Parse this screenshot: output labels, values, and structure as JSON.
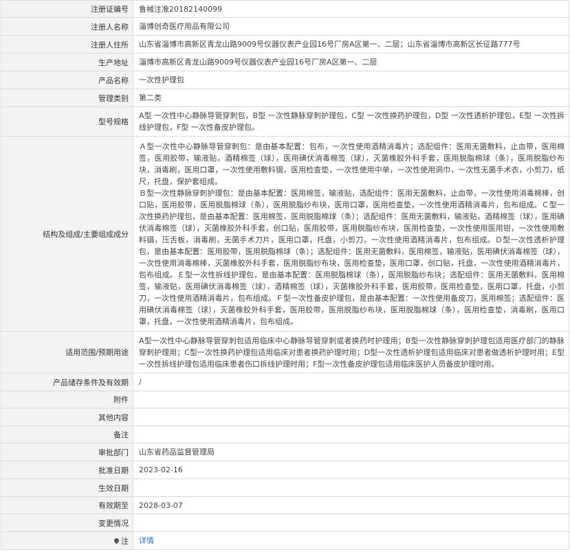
{
  "rows": [
    {
      "label": "注册证编号",
      "value": "鲁械注准20182140099"
    },
    {
      "label": "注册人名称",
      "value": "淄博创奇医疗用品有限公司"
    },
    {
      "label": "注册人住所",
      "value": "山东省淄博市高新区青龙山路9009号仪器仪表产业园16号厂房A区第一、二层；山东省淄博市高新区长征路777号"
    },
    {
      "label": "生产地址",
      "value": "淄博市高新区青龙山路9009号仪器仪表产业园16号厂房A区第一、二层"
    },
    {
      "label": "产品名称",
      "value": "一次性护理包"
    },
    {
      "label": "管理类别",
      "value": "第二类"
    },
    {
      "label": "型号规格",
      "value": "A型 一次性中心静脉导管穿刺包，B型 一次性静脉穿刺护理包，C型 一次性换药护理包，D型 一次性透析护理包，E型 一次性拆线护理包，F型 一次性备皮护理包。"
    },
    {
      "label": "结构及组成/主要组成成分",
      "value": "Ａ型一次性中心静脉导管穿刺包：是由基本配置：包布，一次性使用酒精消毒片；选配组件：医用无菌敷料，止血带，医用棉签，医用胶带，输液贴，酒精棉签（球），医用碘伏消毒棉签（球），灭菌橡胶外科手套，医用脱脂棉球（条），医用脱脂纱布块，消毒刷，医用口罩，一次性使用敷料镊，医用检查垫，一次性使用中单，一次性使用洞巾，一次性无菌手术衣，小剪刀，纸尺，托盘，保护套组成。\nＢ型一次性静脉穿刺护理包：是由基本配置：医用棉签，输液贴，选配组件：医用无菌敷料，止血带，一次性使用消毒棉棒，创口贴，医用胶带，医用脱脂棉球（条），医用脱脂纱布块，医用口罩，医用检查垫，一次性使用酒精消毒片，包布组成。Ｃ型一次性换药护理包，是由基本配置：医用棉签，医用脱脂棉球（条）；选配组件：医用无菌敷料，输液贴，酒精棉签（球），医用碘伏消毒棉签（球），灭菌橡胶外科手套，创口贴，医用胶带，医用脱脂纱布块，医用检查垫，一次性使用医用钳，一次性使用敷料镊，压舌板，消毒刷，无菌手术刀片，医用口罩，托盘，小剪刀，一次性使用酒精消毒片，包布组成。Ｄ型一次性透析护理包，是由基本配置：医用胶带，医用脱脂棉球（条）；选配组件：医用无菌敷料，医用棉签，输液贴，医用碘伏消毒棉签（球），一次性使用消毒棉棒，灭菌橡胶外科手套，医用脱脂纱布块，医用检查垫，医用口罩，创口贴，托盘，一次性使用酒精消毒片，包布组成。Ｅ型一次性拆线护理包，是由基本配置：医用脱脂棉球（条），医用脱脂纱布块；选配组件：医用无菌敷料，医用棉签，输液贴，医用碘伏消毒棉签（球），酒精棉签（球），灭菌橡胶外科手套，医用胶带，医用检查垫，医用口罩，托盘，小剪刀，一次性使用酒精消毒片，包布组成。Ｆ型一次性备皮护理包，是由基本配置：一次性使用备皮刀，医用棉签；选配组件：医用碘伏消毒棉签（球），灭菌橡胶外科手套，医用胶带，医用脱脂纱布块，医用脱脂棉球（条），医用检查垫，消毒刷，医用口罩，托盘，一次性使用酒精消毒片，包布组成。"
    },
    {
      "label": "适用范围/预期用途",
      "value": "A型一次性中心静脉导管穿刺包适用临床中心静脉导管穿刺或者换药时护理用；B型一次性静脉穿刺护理包适用医疗部门的静脉穿刺护理用；C型一次性换药护理包适用临床对患者换药护理时用；D型一次性透析护理包适用临床对患者做透析护理时用；E型一次性拆线护理包适用临床患者伤口拆线护理时用；F型一次性备皮护理包适用临床医护人员备皮护理时用。"
    },
    {
      "label": "产品储存条件及有效期",
      "value": "/"
    },
    {
      "label": "附件",
      "value": ""
    },
    {
      "label": "其他内容",
      "value": ""
    },
    {
      "label": "备注",
      "value": ""
    },
    {
      "label": "审批部门",
      "value": "山东省药品监督管理局"
    },
    {
      "label": "批准日期",
      "value": "2023-02-16"
    },
    {
      "label": "生效日期",
      "value": ""
    },
    {
      "label": "有效期至",
      "value": "2028-03-07"
    },
    {
      "label": "变更情况",
      "value": ""
    }
  ],
  "note": {
    "label": "注",
    "icon": "location-pin-icon",
    "link_text": "详情",
    "link_color": "#2c6fb7"
  }
}
